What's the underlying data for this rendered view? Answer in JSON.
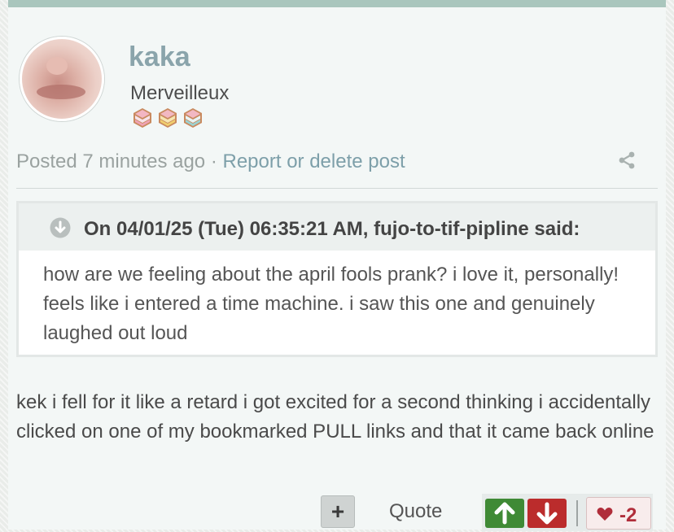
{
  "post": {
    "username": "kaka",
    "rank": "Merveilleux",
    "badges": [
      "pink-macaron-icon",
      "yellow-macaron-icon",
      "teal-macaron-icon"
    ],
    "posted_prefix": "Posted ",
    "posted_time": "7 minutes ago",
    "separator": " · ",
    "report_link": "Report or delete post",
    "body": "kek i fell for it like a retard i got excited for a second thinking i accidentally clicked on one of my bookmarked PULL links and that it came back online"
  },
  "quote": {
    "header": "On 04/01/25 (Tue) 06:35:21 AM, fujo-to-tif-pipline said:",
    "text": "how are we feeling about the april fools prank? i love it, personally! feels like i entered a time machine. i saw this one and genuinely laughed out loud"
  },
  "actions": {
    "plus_label": "+",
    "quote_label": "Quote",
    "score": "-2"
  },
  "colors": {
    "accent": "#a9c6bd",
    "username": "#8aa4ab",
    "link": "#7d9fa9",
    "upvote": "#3f8a35",
    "downvote": "#bb2c2c",
    "like": "#b02d3a"
  }
}
